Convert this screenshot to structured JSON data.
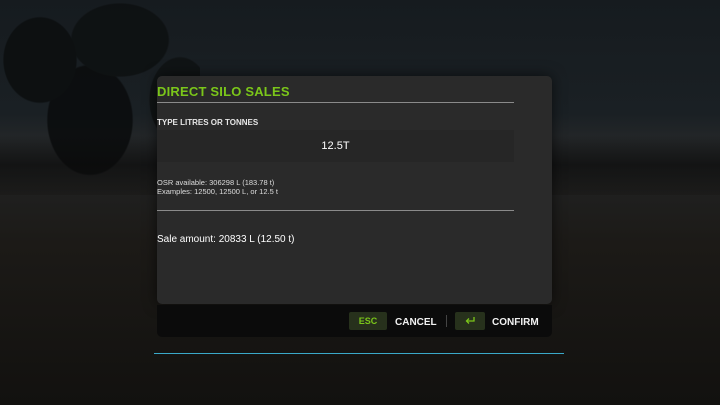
{
  "dialog": {
    "title": "DIRECT SILO SALES",
    "field_label": "TYPE LITRES OR TONNES",
    "input_value": "12.5T",
    "info_available": "OSR available: 306298 L (183.78 t)",
    "info_examples": "Examples: 12500, 12500 L, or 12.5 t",
    "sale_amount": "Sale amount: 20833 L (12.50 t)"
  },
  "buttons": {
    "cancel_key": "ESC",
    "cancel_label": "CANCEL",
    "confirm_key_icon": "enter-icon",
    "confirm_label": "CONFIRM"
  },
  "colors": {
    "accent": "#7bc61a",
    "dialog_bg": "#2a2a2a",
    "bar_bg": "#0b0b0b",
    "highlight_line": "#3aa9c9"
  }
}
